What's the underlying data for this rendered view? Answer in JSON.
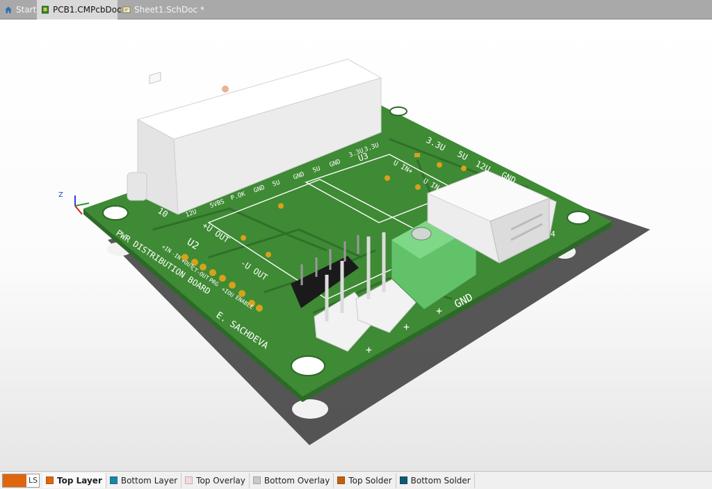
{
  "tabs": [
    {
      "label": "Start",
      "icon": "home-icon"
    },
    {
      "label": "PCB1.CMPcbDoc",
      "icon": "pcb-document-icon"
    },
    {
      "label": "Sheet1.SchDoc *",
      "icon": "schematic-document-icon"
    }
  ],
  "board": {
    "title": "PWR DISTRIBUTION BOARD",
    "author": "E. SACHDEVA",
    "u2": "U2",
    "u3": "U3",
    "u2_pins": [
      "+IN",
      "-IN",
      "+OUT",
      "CT-OUT",
      "PRG",
      "+IOU",
      "ENABLE"
    ],
    "atx_labels": [
      "12U",
      "5VBS",
      "P.OK",
      "GND",
      "5U",
      "GND",
      "5U",
      "GND",
      "3.3U",
      "3.3U"
    ],
    "pin10": "10",
    "u_out_plus": "+U OUT",
    "u_out_minus": "-U OUT",
    "u_in_plus": "U IN+",
    "u_in_minus": "U IN-",
    "rail_labels": [
      "3.3U",
      "5U",
      "12U",
      "GND"
    ],
    "terminal_labels": [
      "+",
      "GND"
    ],
    "header_plus": [
      "+",
      "+"
    ],
    "usb_pin": "4",
    "colors": {
      "board": "#3f8a35",
      "board_edge": "#2c6a27",
      "silk": "#ffffff",
      "terminal": "#62c26a",
      "pad": "#d6a21a"
    }
  },
  "layers": {
    "ls_label": "LS",
    "items": [
      {
        "label": "Top Layer",
        "color": "#e0660e",
        "active": true
      },
      {
        "label": "Bottom Layer",
        "color": "#1a85a8",
        "active": false
      },
      {
        "label": "Top Overlay",
        "color": "#f4dada",
        "active": false
      },
      {
        "label": "Bottom Overlay",
        "color": "#c8c8d4",
        "active": false
      },
      {
        "label": "Top Solder",
        "color": "#c0600e",
        "active": false
      },
      {
        "label": "Bottom Solder",
        "color": "#0d5a73",
        "active": false
      }
    ]
  }
}
